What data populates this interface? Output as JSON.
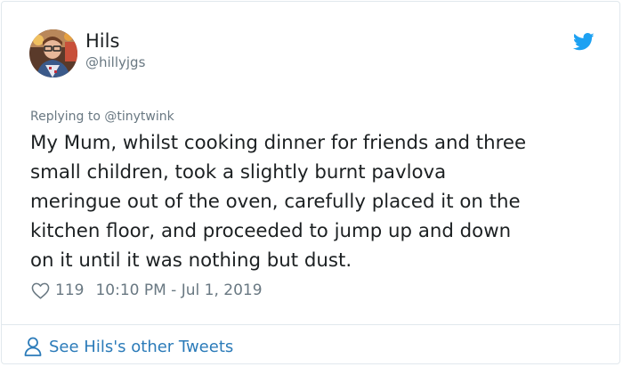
{
  "author": {
    "display_name": "Hils",
    "handle": "@hillyjgs"
  },
  "reply": {
    "text": "Replying to @tinytwink"
  },
  "tweet": {
    "lines": [
      "My Mum, whilst cooking dinner for friends and three",
      "small children, took a slightly burnt pavlova",
      "meringue out of the oven, carefully placed it on the",
      "kitchen floor, and proceeded to jump up and down",
      "on it until it was nothing but dust."
    ]
  },
  "meta": {
    "likes": "119",
    "timestamp": "10:10 PM - Jul 1, 2019"
  },
  "footer": {
    "link_label": "See Hils's other Tweets"
  },
  "icons": {
    "brand": "twitter-bird-icon",
    "like": "heart-icon",
    "profile": "person-icon"
  },
  "colors": {
    "brand_blue": "#1da1f2",
    "link_blue": "#2b7bb9",
    "secondary_text": "#697882",
    "primary_text": "#1c2022",
    "border": "#e1e8ed"
  }
}
